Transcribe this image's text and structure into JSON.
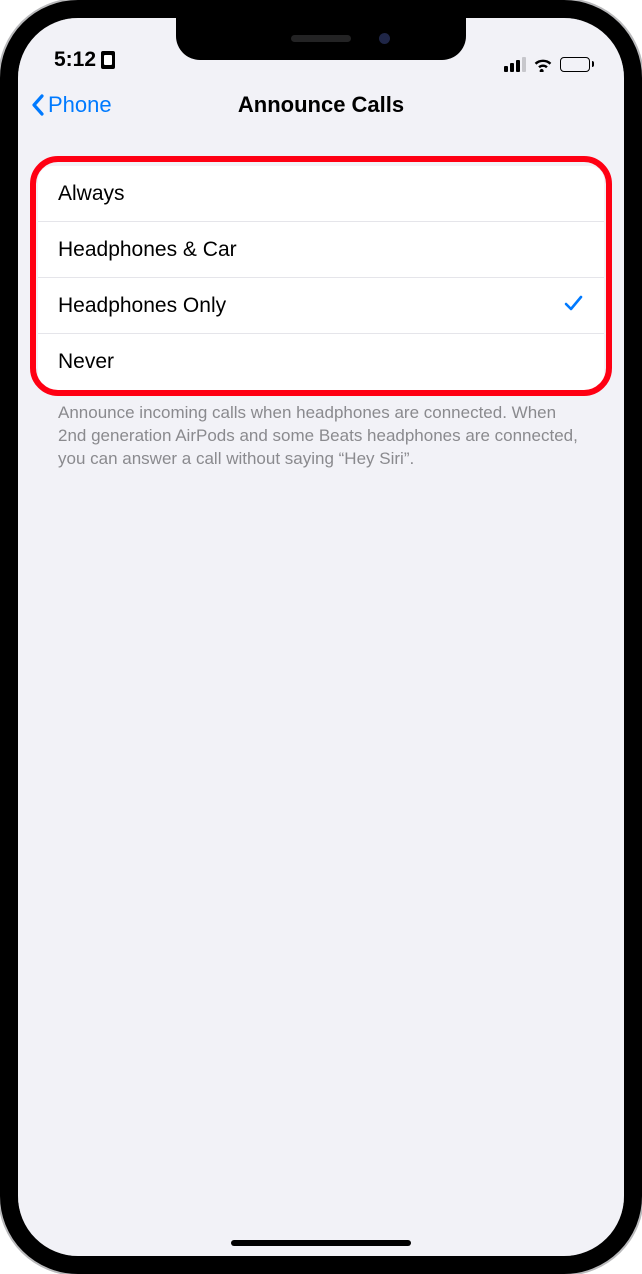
{
  "status": {
    "time": "5:12"
  },
  "nav": {
    "back_label": "Phone",
    "title": "Announce Calls"
  },
  "options": [
    {
      "label": "Always",
      "selected": false
    },
    {
      "label": "Headphones & Car",
      "selected": false
    },
    {
      "label": "Headphones Only",
      "selected": true
    },
    {
      "label": "Never",
      "selected": false
    }
  ],
  "footer": "Announce incoming calls when headphones are connected. When 2nd generation AirPods and some Beats headphones are connected, you can answer a call without saying “Hey Siri”.",
  "colors": {
    "tint": "#007aff",
    "highlight": "#ff0013",
    "background": "#f2f2f7"
  }
}
